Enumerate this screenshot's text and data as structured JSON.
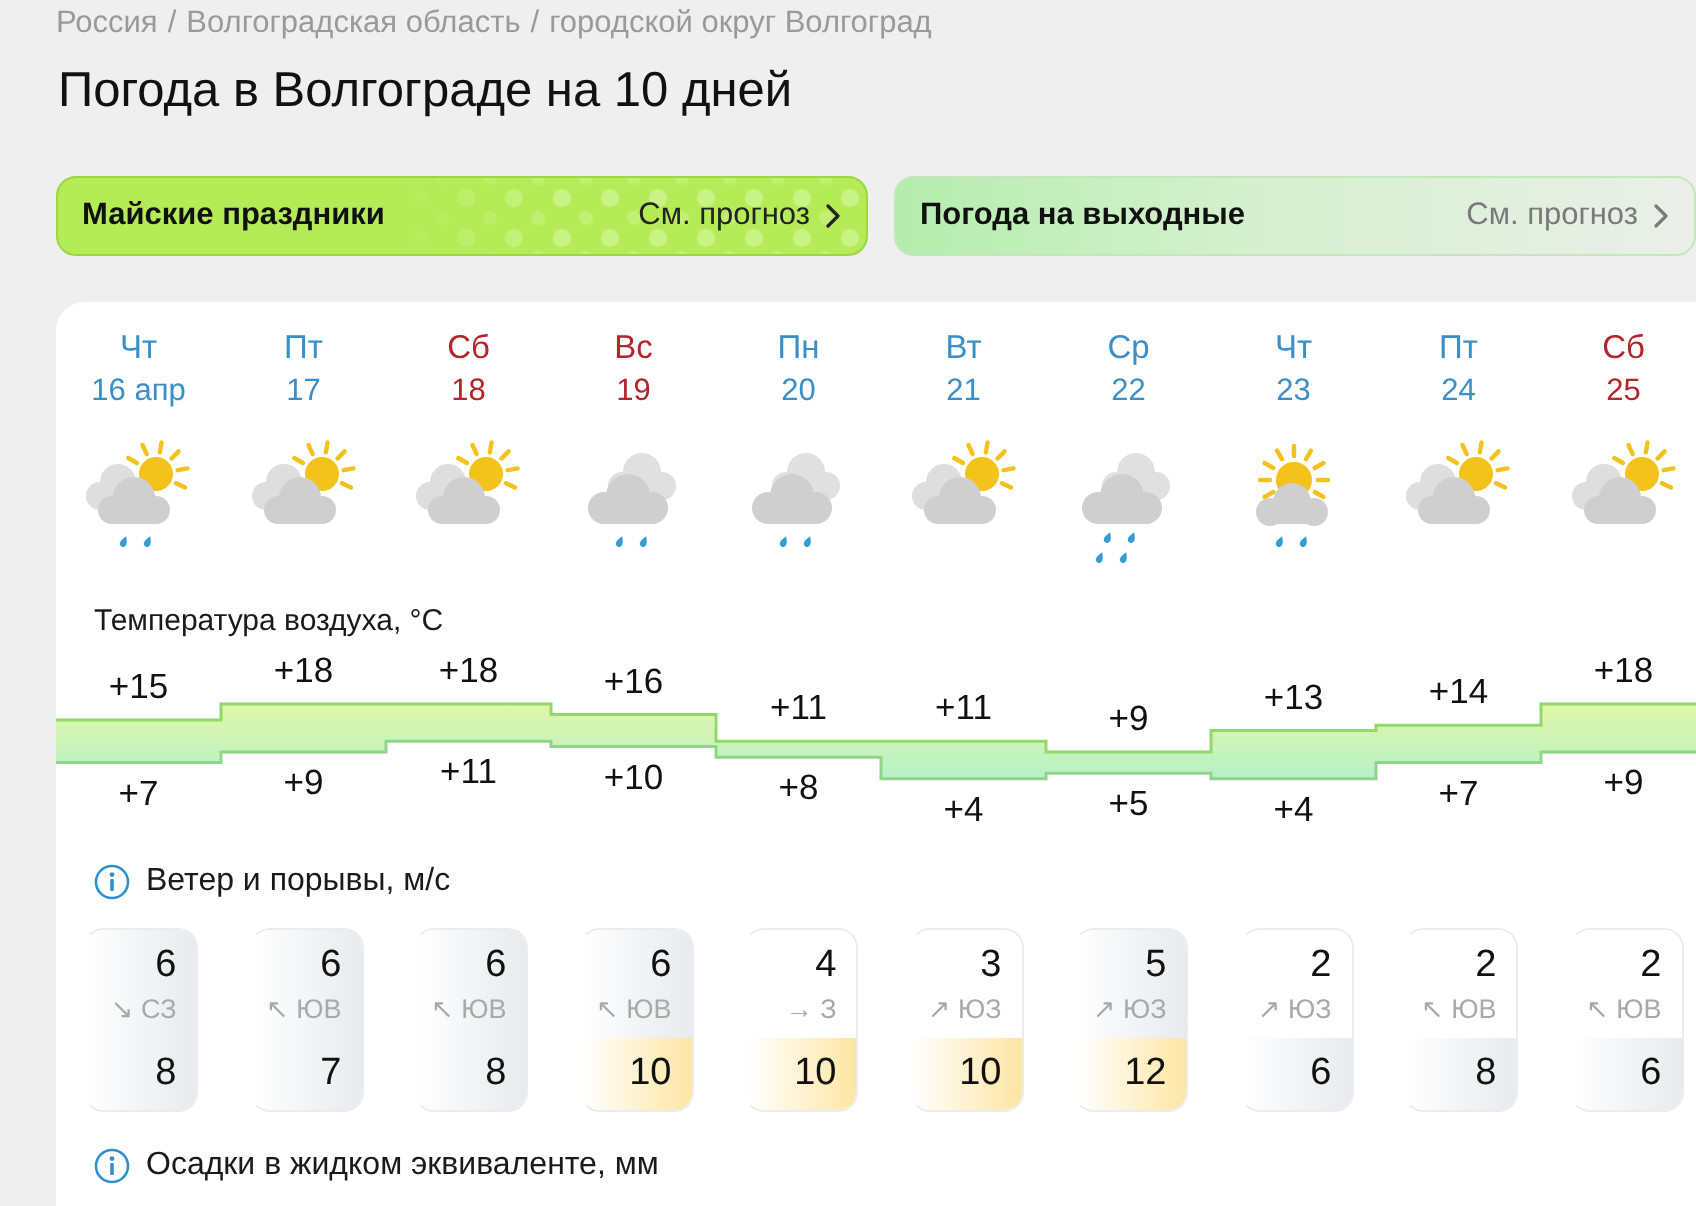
{
  "breadcrumb": {
    "items": [
      {
        "label": "Россия"
      },
      {
        "label": "Волгоградская область"
      },
      {
        "label": "городской округ Волгоград"
      }
    ],
    "separators": [
      "/",
      "/"
    ]
  },
  "title": "Погода в Волгограде на 10 дней",
  "banners": [
    {
      "kind": "holiday",
      "title": "Майские праздники",
      "link": "См. прогноз"
    },
    {
      "kind": "weekend",
      "title": "Погода на выходные",
      "link": "См. прогноз"
    }
  ],
  "forecast": {
    "days": [
      {
        "weekday": "Чт",
        "date": "16 апр",
        "weekend": false,
        "kind": "partly_rain"
      },
      {
        "weekday": "Пт",
        "date": "17",
        "weekend": false,
        "kind": "partly"
      },
      {
        "weekday": "Сб",
        "date": "18",
        "weekend": true,
        "kind": "partly"
      },
      {
        "weekday": "Вс",
        "date": "19",
        "weekend": true,
        "kind": "overcast_rain"
      },
      {
        "weekday": "Пн",
        "date": "20",
        "weekend": false,
        "kind": "overcast_rain"
      },
      {
        "weekday": "Вт",
        "date": "21",
        "weekend": false,
        "kind": "partly"
      },
      {
        "weekday": "Ср",
        "date": "22",
        "weekend": false,
        "kind": "overcast_showers"
      },
      {
        "weekday": "Чт",
        "date": "23",
        "weekend": false,
        "kind": "sunny_rain"
      },
      {
        "weekday": "Пт",
        "date": "24",
        "weekend": false,
        "kind": "partly"
      },
      {
        "weekday": "Сб",
        "date": "25",
        "weekend": true,
        "kind": "partly"
      }
    ],
    "temperature": {
      "title": "Температура воздуха, °C",
      "highs": [
        "+15",
        "+18",
        "+18",
        "+16",
        "+11",
        "+11",
        "+9",
        "+13",
        "+14",
        "+18"
      ],
      "lows": [
        "+7",
        "+9",
        "+11",
        "+10",
        "+8",
        "+4",
        "+5",
        "+4",
        "+7",
        "+9"
      ]
    },
    "wind": {
      "title": "Ветер и порывы, м/с",
      "items": [
        {
          "speed": "6",
          "direction": "↘ СЗ",
          "gust": "8",
          "strong_wind": true,
          "strong_gust": false
        },
        {
          "speed": "6",
          "direction": "↖ ЮВ",
          "gust": "7",
          "strong_wind": true,
          "strong_gust": false
        },
        {
          "speed": "6",
          "direction": "↖ ЮВ",
          "gust": "8",
          "strong_wind": true,
          "strong_gust": false
        },
        {
          "speed": "6",
          "direction": "↖ ЮВ",
          "gust": "10",
          "strong_wind": true,
          "strong_gust": true
        },
        {
          "speed": "4",
          "direction": "→ З",
          "gust": "10",
          "strong_wind": false,
          "strong_gust": true
        },
        {
          "speed": "3",
          "direction": "↗ ЮЗ",
          "gust": "10",
          "strong_wind": false,
          "strong_gust": true
        },
        {
          "speed": "5",
          "direction": "↗ ЮЗ",
          "gust": "12",
          "strong_wind": true,
          "strong_gust": true
        },
        {
          "speed": "2",
          "direction": "↗ ЮЗ",
          "gust": "6",
          "strong_wind": false,
          "strong_gust": false
        },
        {
          "speed": "2",
          "direction": "↖ ЮВ",
          "gust": "8",
          "strong_wind": false,
          "strong_gust": false
        },
        {
          "speed": "2",
          "direction": "↖ ЮВ",
          "gust": "6",
          "strong_wind": false,
          "strong_gust": false
        }
      ]
    },
    "precipitation": {
      "title": "Осадки в жидком эквиваленте, мм"
    }
  }
}
